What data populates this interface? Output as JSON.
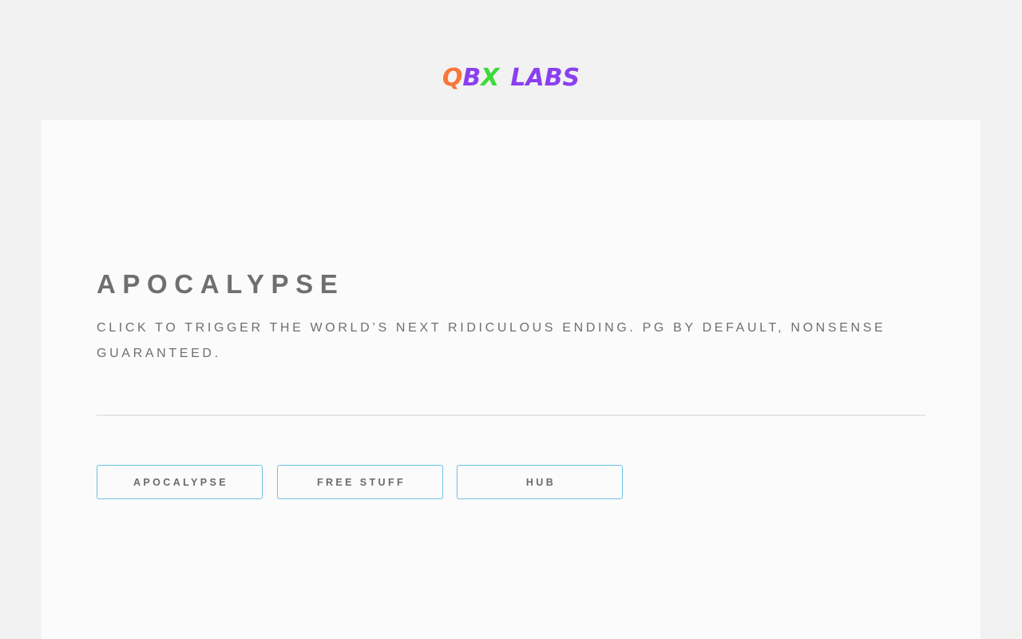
{
  "logo": {
    "parts": [
      {
        "text": "Q",
        "color": "#f7773a"
      },
      {
        "text": "B",
        "color": "#8a3ff0"
      },
      {
        "text": "X",
        "color": "#3fd93b"
      },
      {
        "text": "LABS",
        "color": "#8a3ff0"
      }
    ]
  },
  "main": {
    "title": "APOCALYPSE",
    "subtitle": "CLICK TO TRIGGER THE WORLD’S NEXT RIDICULOUS ENDING. PG BY DEFAULT, NONSENSE GUARANTEED."
  },
  "buttons": [
    {
      "label": "APOCALYPSE"
    },
    {
      "label": "FREE STUFF"
    },
    {
      "label": "HUB"
    }
  ],
  "colors": {
    "page_bg": "#f2f2f2",
    "card_bg": "#fbfbfb",
    "text": "#6f6f6f",
    "button_border": "#6ec1e4",
    "divider": "#e6e6e6"
  }
}
